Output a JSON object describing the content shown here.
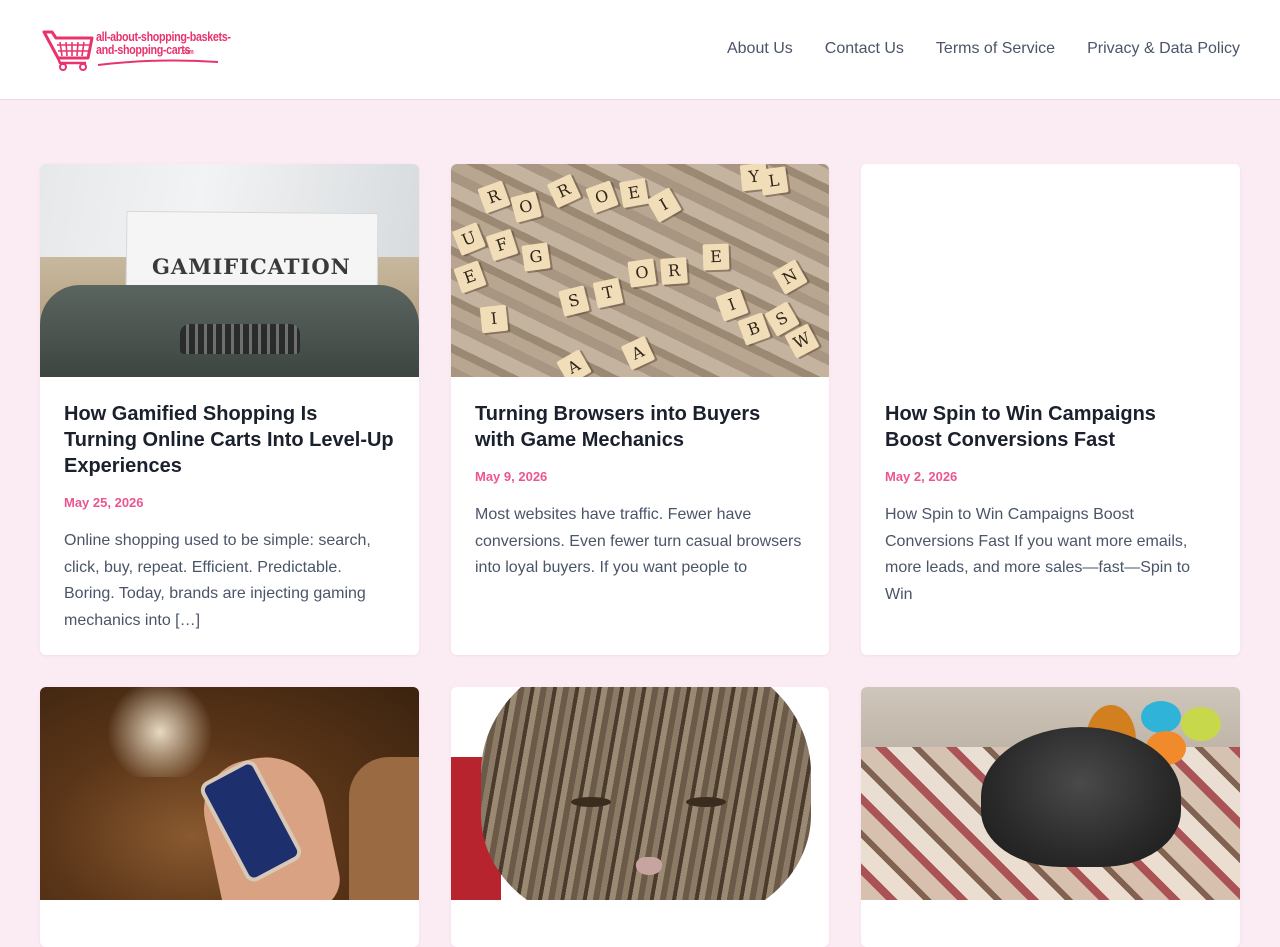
{
  "header": {
    "logo": {
      "line1": "all-about-shopping-baskets-",
      "line2": "and-shopping-carts",
      "suffix": ".com"
    },
    "nav": [
      {
        "label": "About Us"
      },
      {
        "label": "Contact Us"
      },
      {
        "label": "Terms of Service"
      },
      {
        "label": "Privacy & Data Policy"
      }
    ]
  },
  "posts": [
    {
      "title": "How Gamified Shopping Is Turning Online Carts Into Level-Up Experiences",
      "date": "May 25, 2026",
      "excerpt": "Online shopping used to be simple: search, click, buy, repeat. Efficient. Predictable. Boring. Today, brands are injecting gaming mechanics into […]",
      "image_text": "GAMIFICATION"
    },
    {
      "title": "Turning Browsers into Buyers with Game Mechanics",
      "date": "May 9, 2026",
      "excerpt": "Most websites have traffic. Fewer have conversions. Even fewer turn casual browsers into loyal buyers. If you want people to"
    },
    {
      "title": "How Spin to Win Campaigns Boost Conversions Fast",
      "date": "May 2, 2026",
      "excerpt": "How Spin to Win Campaigns Boost Conversions Fast If you want more emails, more leads, and more sales—fast—Spin to Win"
    }
  ],
  "colors": {
    "brand": "#e8336d",
    "date": "#ec5591",
    "page_bg": "#fbecf4"
  }
}
